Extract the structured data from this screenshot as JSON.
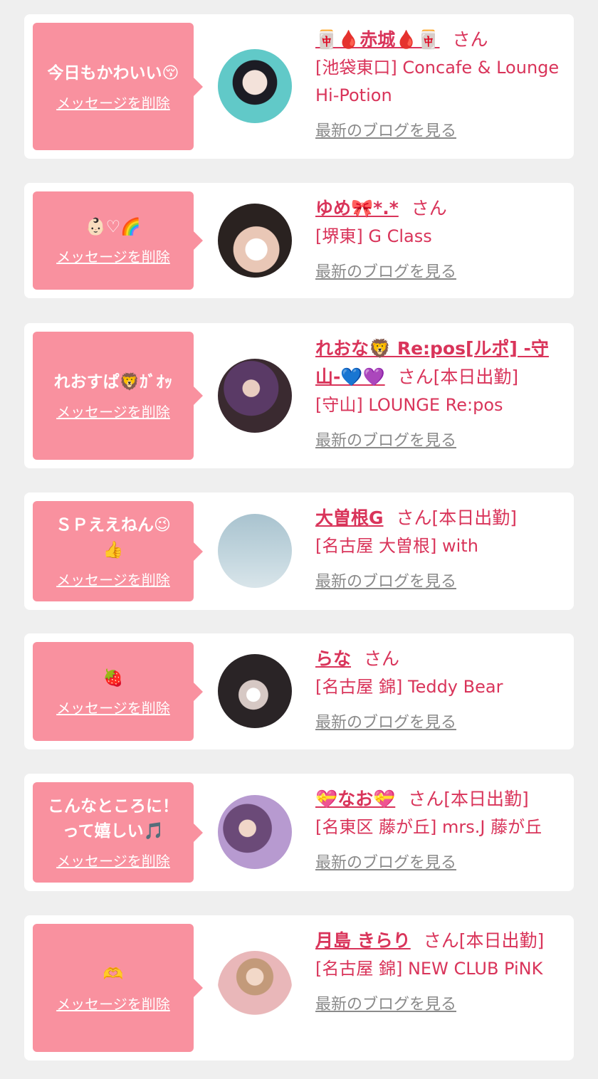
{
  "delete_label": "メッセージを削除",
  "blog_label": "最新のブログを見る",
  "san_label": "さん",
  "colors": {
    "accent": "#d9345a",
    "bubble": "#f9919f",
    "background": "#efefef"
  },
  "cards": [
    {
      "message": "今日もかわいい😚",
      "name": "🀄🩸赤城🩸🀄",
      "status": "",
      "shop": "[池袋東口] Concafe & Lounge Hi-Potion"
    },
    {
      "message": "👶🏻♡🌈",
      "name": "ゆめ🎀*.*",
      "status": "",
      "shop": "[堺東] G Class"
    },
    {
      "message": "れおすぱ🦁ｶﾞｵｯ",
      "name": "れおな🦁 Re:pos[ルポ] -守山-💙💜",
      "status": "[本日出勤]",
      "shop": "[守山] LOUNGE Re:pos"
    },
    {
      "message": "ＳＰええねん😉\n👍",
      "name": "大曽根G",
      "status": "[本日出勤]",
      "shop": "[名古屋 大曽根] with"
    },
    {
      "message": "🍓",
      "name": "らな",
      "status": "",
      "shop": "[名古屋 錦] Teddy Bear"
    },
    {
      "message": "こんなところに！\nって嬉しい🎵",
      "name": "💝なお💝",
      "status": "[本日出勤]",
      "shop": "[名東区 藤が丘] mrs.J 藤が丘"
    },
    {
      "message": "🫶",
      "name": "月島 きらり",
      "status": "[本日出勤]",
      "shop": "[名古屋 錦] NEW CLUB PiNK"
    }
  ]
}
